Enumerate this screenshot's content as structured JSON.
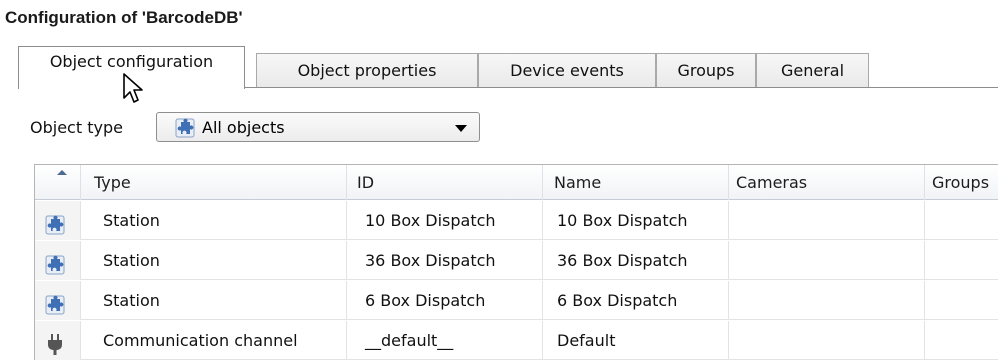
{
  "window": {
    "title": "Configuration of 'BarcodeDB'"
  },
  "tabs": [
    {
      "label": "Object configuration",
      "active": true
    },
    {
      "label": "Object properties",
      "active": false
    },
    {
      "label": "Device events",
      "active": false
    },
    {
      "label": "Groups",
      "active": false
    },
    {
      "label": "General",
      "active": false
    }
  ],
  "object_type": {
    "label": "Object type",
    "selected": "All objects",
    "icon": "puzzle-piece-icon"
  },
  "table": {
    "sort_indicator": "sort-ascending-icon",
    "columns": [
      "",
      "Type",
      "ID",
      "Name",
      "Cameras",
      "Groups"
    ],
    "rows": [
      {
        "icon": "puzzle-piece-icon",
        "type": "Station",
        "id": "10 Box Dispatch",
        "name": "10 Box Dispatch",
        "cameras": "",
        "groups": ""
      },
      {
        "icon": "puzzle-piece-icon",
        "type": "Station",
        "id": "36 Box Dispatch",
        "name": "36 Box Dispatch",
        "cameras": "",
        "groups": ""
      },
      {
        "icon": "puzzle-piece-icon",
        "type": "Station",
        "id": "6 Box Dispatch",
        "name": "6 Box Dispatch",
        "cameras": "",
        "groups": ""
      },
      {
        "icon": "plug-icon",
        "type": "Communication channel",
        "id": "__default__",
        "name": "Default",
        "cameras": "",
        "groups": ""
      }
    ]
  },
  "colors": {
    "puzzle_icon": "#3f6fb5",
    "plug_icon": "#555555",
    "tab_border": "#8d8d8d"
  }
}
